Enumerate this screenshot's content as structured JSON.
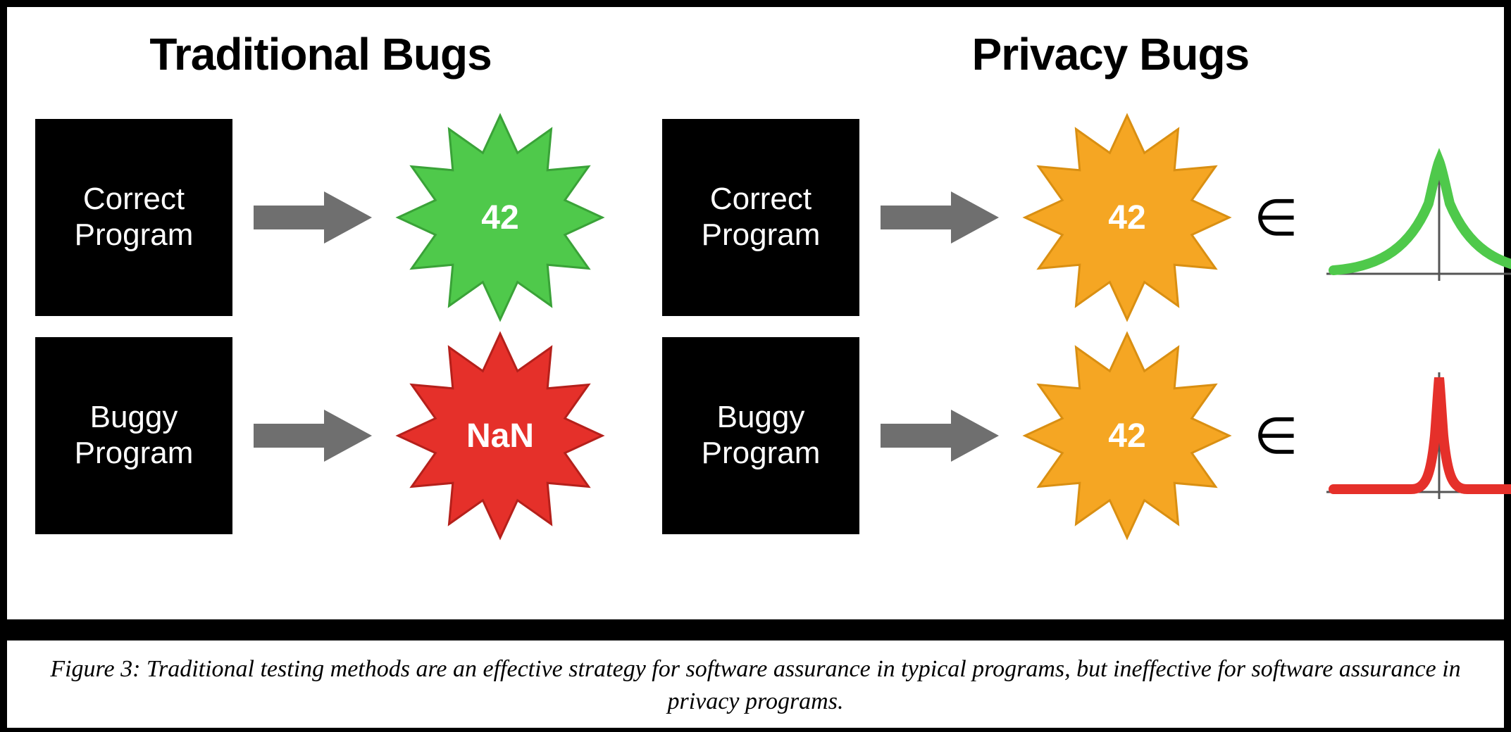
{
  "left": {
    "title": "Traditional Bugs",
    "row1": {
      "box": "Correct\nProgram",
      "burst_value": "42",
      "burst_color": "#4fc94b"
    },
    "row2": {
      "box": "Buggy\nProgram",
      "burst_value": "NaN",
      "burst_color": "#e5302a"
    }
  },
  "right": {
    "title": "Privacy Bugs",
    "row1": {
      "box": "Correct\nProgram",
      "burst_value": "42",
      "burst_color": "#f5a623",
      "dist_color": "#4fc94b",
      "dist_type": "wide"
    },
    "row2": {
      "box": "Buggy\nProgram",
      "burst_value": "42",
      "burst_color": "#f5a623",
      "dist_color": "#e5302a",
      "dist_type": "narrow"
    },
    "element_of": "∈"
  },
  "caption": "Figure 3: Traditional testing methods are an effective strategy for software assurance in typical programs, but ineffective for software assurance in privacy programs."
}
